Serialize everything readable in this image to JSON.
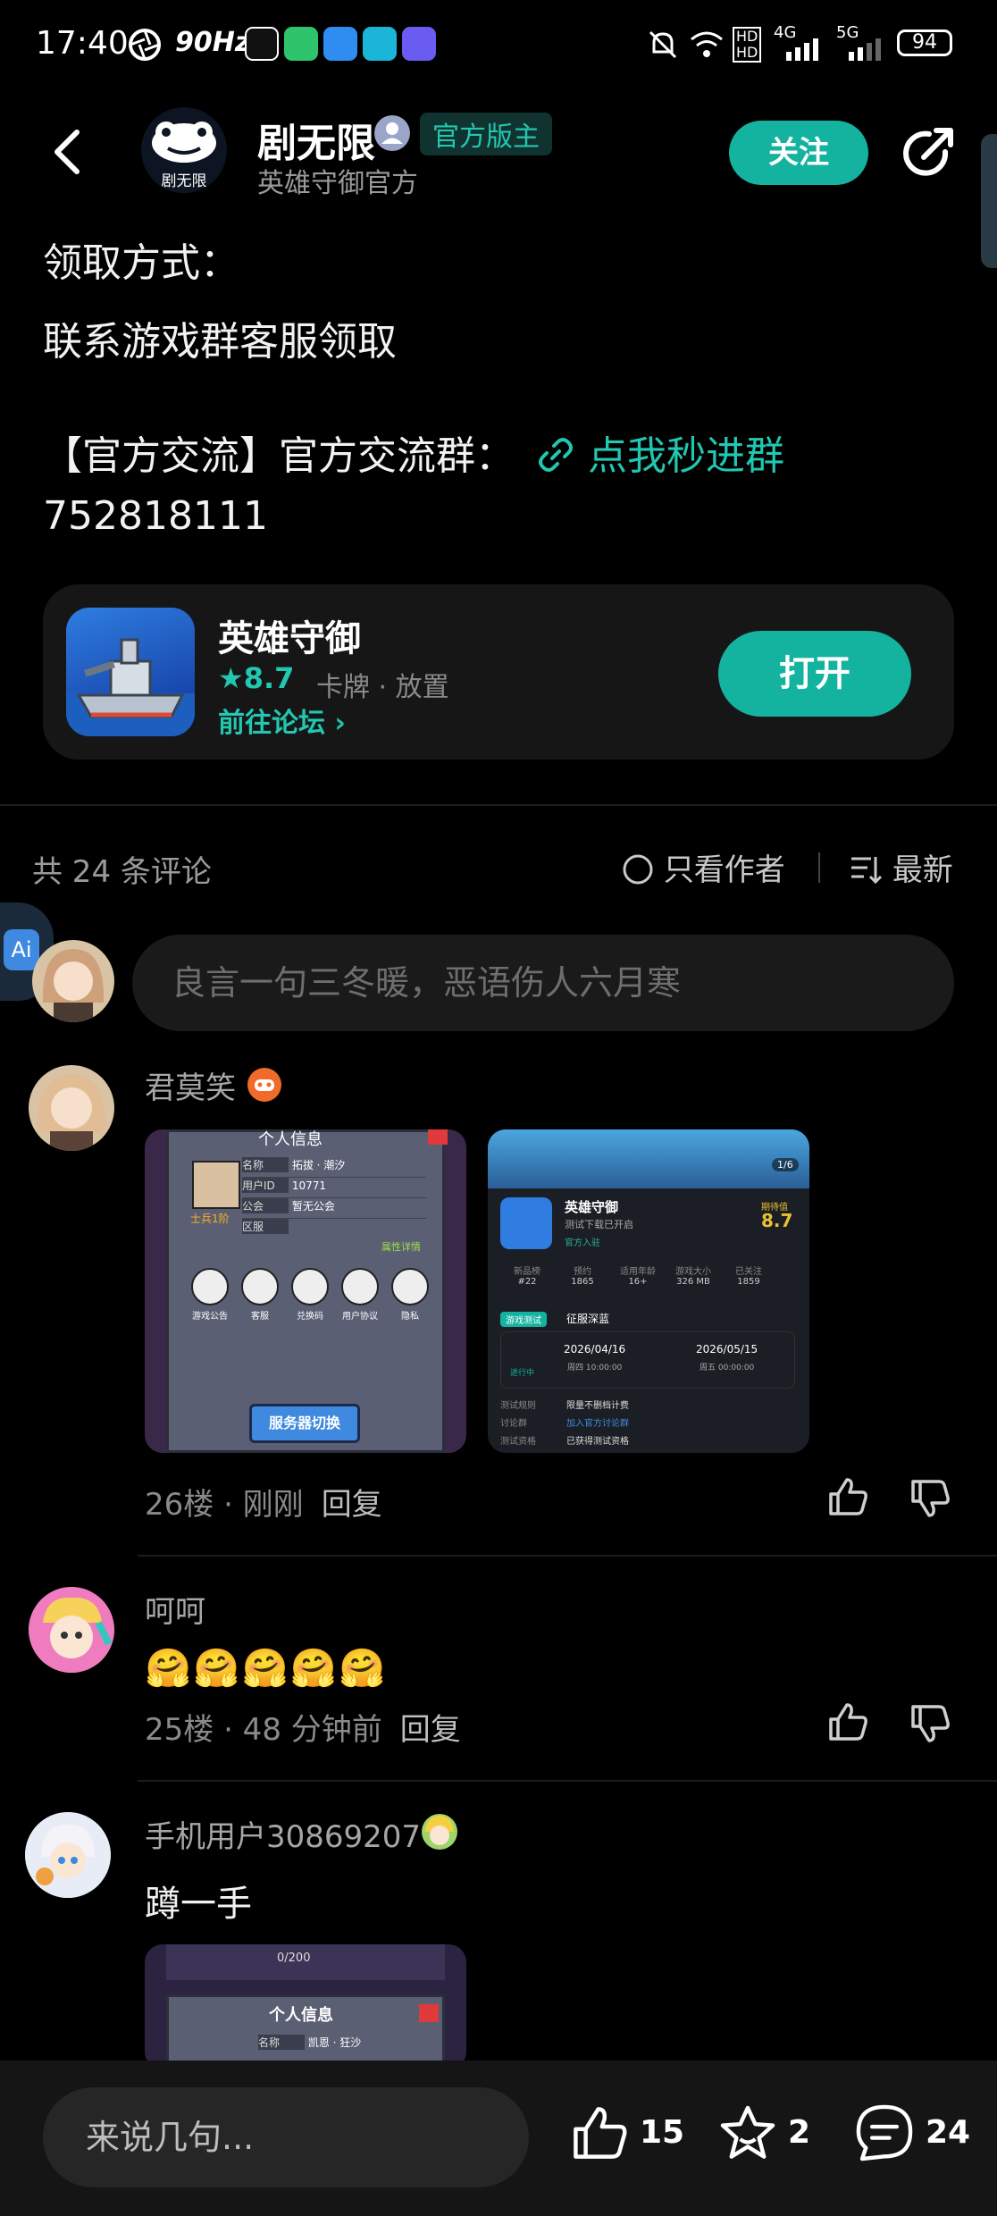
{
  "status_bar": {
    "time": "17:40",
    "refresh": "90Hz",
    "battery": "94",
    "net1": "4G",
    "net2": "5G"
  },
  "header": {
    "account_name": "剧无限",
    "avatar_text": "剧无限",
    "official_badge": "官方版主",
    "subtitle": "英雄守御官方",
    "follow_label": "关注"
  },
  "post": {
    "claim_method_label": "领取方式：",
    "claim_method_text": "联系游戏群客服领取",
    "group_prefix": "【官方交流】官方交流群：",
    "group_link": "点我秒进群",
    "group_number": "752818111"
  },
  "game_card": {
    "name": "英雄守御",
    "rating": "8.7",
    "tags": "卡牌 · 放置",
    "forum_link": "前往论坛",
    "open_label": "打开"
  },
  "comments_header": {
    "count_text": "共 24 条评论",
    "only_author": "只看作者",
    "sort_label": "最新"
  },
  "comment_input": {
    "placeholder": "良言一句三冬暖，恶语伤人六月寒"
  },
  "comments": [
    {
      "user": "君莫笑",
      "meta": "26楼 · 刚刚",
      "reply": "回复",
      "images": [
        {
          "title": "个人信息",
          "rows": [
            [
              "名称",
              "拓拔 · 潮汐"
            ],
            [
              "用户ID",
              "10771"
            ],
            [
              "公会",
              "暂无公会"
            ],
            [
              "区服",
              ""
            ]
          ],
          "rank": "士兵1阶",
          "detail_link": "属性详情",
          "icons": [
            "游戏公告",
            "客服",
            "兑换码",
            "用户协议",
            "隐私"
          ],
          "button": "服务器切换"
        },
        {
          "page": "1/6",
          "game_name": "英雄守御",
          "game_sub": "测试下载已开启",
          "official": "官方入驻",
          "expect_label": "期待值",
          "expect_value": "8.7",
          "stats": [
            [
              "#22",
              "新品榜"
            ],
            [
              "1865",
              "预约"
            ],
            [
              "16+",
              "适用年龄"
            ],
            [
              "326 MB",
              "游戏大小"
            ],
            [
              "1859",
              "已关注"
            ]
          ],
          "test_tag": "游戏测试",
          "test_name": "征服深蓝",
          "status": "进行中",
          "start_date": "2026/04/16",
          "start_time": "周四 10:00:00",
          "end_date": "2026/05/15",
          "end_time": "周五 00:00:00",
          "rules": [
            [
              "测试规则",
              "限量不删档计费"
            ],
            [
              "讨论群",
              "加入官方讨论群"
            ],
            [
              "测试资格",
              "已获得测试资格"
            ]
          ]
        }
      ]
    },
    {
      "user": "呵呵",
      "emojis": "🤗🤗🤗🤗🤗",
      "meta": "25楼 · 48 分钟前",
      "reply": "回复"
    },
    {
      "user": "手机用户30869207",
      "text": "蹲一手",
      "image": {
        "progress": "0/200",
        "title": "个人信息",
        "rows": [
          [
            "名称",
            "凯恩 · 狂沙"
          ]
        ]
      }
    }
  ],
  "bottom_bar": {
    "input_placeholder": "来说几句...",
    "likes": "15",
    "favorites": "2",
    "comments": "24"
  },
  "colors": {
    "accent": "#14b3a0",
    "link": "#22c7b1",
    "background": "#000000"
  }
}
